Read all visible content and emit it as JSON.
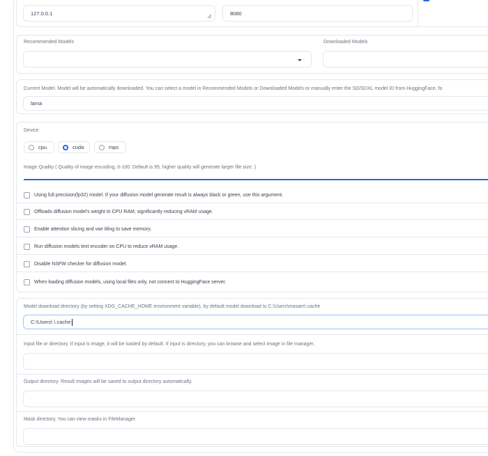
{
  "server": {
    "host_value": "127.0.0.1",
    "port_value": "8080"
  },
  "models": {
    "recommended_label": "Recommended Models",
    "recommended_value": "",
    "downloaded_label": "Downloaded Models",
    "downloaded_value": ""
  },
  "current_model": {
    "label": "Current Model. Model will be automatically downloaded. You can select a model in Recommended Models or Downloaded Models or manually enter the SD/SDXL model ID from HuggingFace, fo",
    "value": "lama"
  },
  "device": {
    "label": "Device",
    "options": [
      "cpu",
      "cuda",
      "mps"
    ],
    "selected": "cuda"
  },
  "image_quality": {
    "label": "Image Quality ( Quality of image encoding, 0-100. Default is 95, higher quality will generate larger file size. )"
  },
  "checkboxes": [
    {
      "label": "Using full precision(fp32) model. If your diffusion model generate result is always black or green, use this argument.",
      "checked": false
    },
    {
      "label": "Offloads diffusion model's weight to CPU RAM, significantly reducing vRAM usage.",
      "checked": false
    },
    {
      "label": "Enable attention slicing and vae tiling to save memory.",
      "checked": false
    },
    {
      "label": "Run diffusion models text encoder on CPU to reduce vRAM usage.",
      "checked": false
    },
    {
      "label": "Disable NSFW checker for diffusion model.",
      "checked": false
    },
    {
      "label": "When loading diffusion models, using local files only, not connect to HuggingFace server.",
      "checked": false
    }
  ],
  "model_dir": {
    "label": "Model download directory (by setting XDG_CACHE_HOME environment variable), by default model download to C:\\Users\\masam\\.cache",
    "value": "C:\\Users\\ \\.cache"
  },
  "input_dir": {
    "label": "Input file or directory. If input is image, it will be loaded by default. If input is directory, you can browse and select image in file manager.",
    "value": ""
  },
  "output_dir": {
    "label": "Output directory. Result images will be saved to output directory automatically.",
    "value": ""
  },
  "mask_dir": {
    "label": "Mask directory. You can view masks in FileManager",
    "value": ""
  },
  "colors": {
    "accent": "#2563eb",
    "border": "#e5e7eb",
    "label": "#6b7280"
  }
}
